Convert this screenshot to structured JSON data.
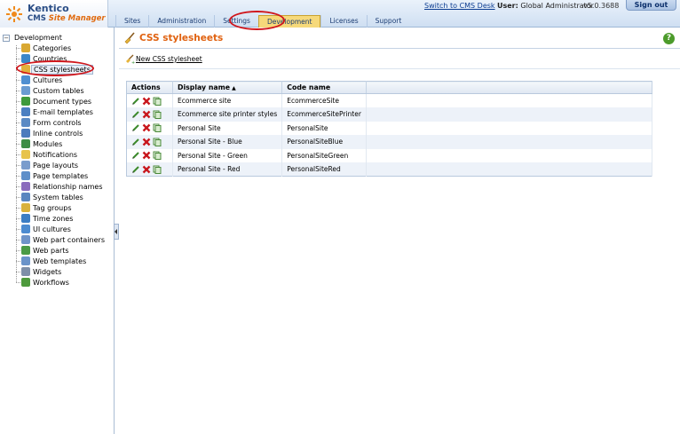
{
  "app": {
    "logo_line1": "Kentico",
    "logo_line2_a": "CMS ",
    "logo_line2_b": "Site Manager"
  },
  "topbar": {
    "switch_link": "Switch to CMS Desk",
    "user_label": "User:",
    "user_name": "Global Administrator",
    "version": "v5.0.3688",
    "signout": "Sign out"
  },
  "tabs": [
    {
      "label": "Sites"
    },
    {
      "label": "Administration"
    },
    {
      "label": "Settings"
    },
    {
      "label": "Development",
      "active": true
    },
    {
      "label": "Licenses"
    },
    {
      "label": "Support"
    }
  ],
  "sidebar": {
    "root": "Development",
    "items": [
      {
        "label": "Categories",
        "icon": "categories-icon",
        "color": "#d9a832"
      },
      {
        "label": "Countries",
        "icon": "globe-icon",
        "color": "#3a86c9"
      },
      {
        "label": "CSS stylesheets",
        "icon": "broom-icon",
        "color": "#e3b13c",
        "selected": true
      },
      {
        "label": "Cultures",
        "icon": "culture-globe-icon",
        "color": "#4f8fd1"
      },
      {
        "label": "Custom tables",
        "icon": "table-icon",
        "color": "#6a9bd1"
      },
      {
        "label": "Document types",
        "icon": "document-types-icon",
        "color": "#3e9a3b"
      },
      {
        "label": "E-mail templates",
        "icon": "email-icon",
        "color": "#4b7fc1"
      },
      {
        "label": "Form controls",
        "icon": "form-controls-icon",
        "color": "#5b8ac4"
      },
      {
        "label": "Inline controls",
        "icon": "inline-controls-icon",
        "color": "#4c7bbd"
      },
      {
        "label": "Modules",
        "icon": "modules-icon",
        "color": "#3d8d46"
      },
      {
        "label": "Notifications",
        "icon": "notification-icon",
        "color": "#e7c34d"
      },
      {
        "label": "Page layouts",
        "icon": "page-layout-icon",
        "color": "#7a9ccc"
      },
      {
        "label": "Page templates",
        "icon": "page-template-icon",
        "color": "#5f8fc9"
      },
      {
        "label": "Relationship names",
        "icon": "relationship-icon",
        "color": "#8a6bbd"
      },
      {
        "label": "System tables",
        "icon": "system-table-icon",
        "color": "#5a86bf"
      },
      {
        "label": "Tag groups",
        "icon": "tag-icon",
        "color": "#d9b13c"
      },
      {
        "label": "Time zones",
        "icon": "clock-icon",
        "color": "#3b7dc4"
      },
      {
        "label": "UI cultures",
        "icon": "ui-culture-icon",
        "color": "#4c8bd0"
      },
      {
        "label": "Web part containers",
        "icon": "container-icon",
        "color": "#6f94c8"
      },
      {
        "label": "Web parts",
        "icon": "web-part-icon",
        "color": "#4a9a45"
      },
      {
        "label": "Web templates",
        "icon": "web-template-icon",
        "color": "#6a93c9"
      },
      {
        "label": "Widgets",
        "icon": "widget-icon",
        "color": "#7e8fa8"
      },
      {
        "label": "Workflows",
        "icon": "workflow-icon",
        "color": "#4e9a3d"
      }
    ]
  },
  "main": {
    "title": "CSS stylesheets",
    "help": "?",
    "new_link": "New CSS stylesheet",
    "grid": {
      "headers": {
        "actions": "Actions",
        "display_name": "Display name",
        "code_name": "Code name"
      },
      "sort_indicator": "▲",
      "rows": [
        {
          "display": "Ecommerce site",
          "code": "EcommerceSite"
        },
        {
          "display": "Ecommerce site printer styles",
          "code": "EcommerceSitePrinter"
        },
        {
          "display": "Personal Site",
          "code": "PersonalSite"
        },
        {
          "display": "Personal Site - Blue",
          "code": "PersonalSiteBlue"
        },
        {
          "display": "Personal Site - Green",
          "code": "PersonalSiteGreen"
        },
        {
          "display": "Personal Site - Red",
          "code": "PersonalSiteRed"
        }
      ]
    }
  },
  "colors": {
    "title": "#e0610f",
    "active_tab": "#f6d97a",
    "annotation_red": "#d0161c"
  }
}
